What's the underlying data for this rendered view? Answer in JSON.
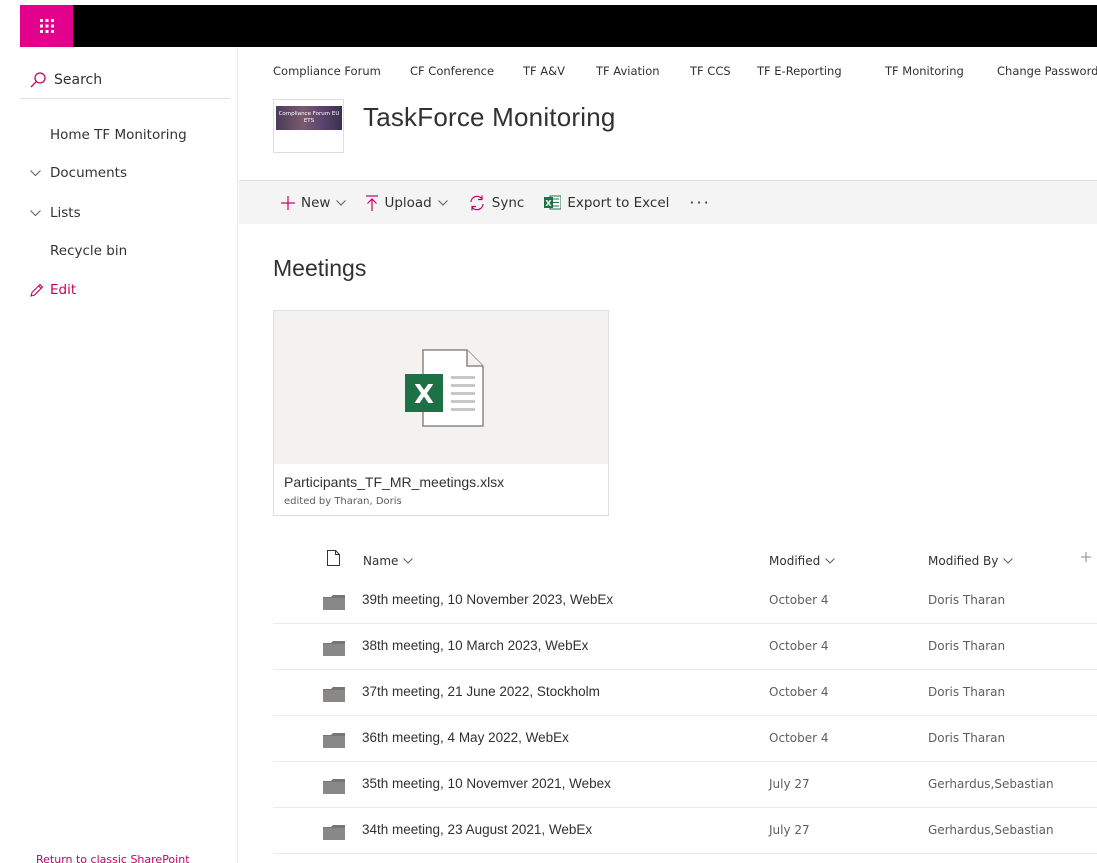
{
  "nav": {
    "search_label": "Search",
    "items": [
      {
        "label": "Home TF Monitoring"
      },
      {
        "label": "Documents"
      },
      {
        "label": "Lists"
      },
      {
        "label": "Recycle bin"
      }
    ],
    "edit_label": "Edit",
    "return_classic": "Return to classic SharePoint"
  },
  "header": {
    "top_links": [
      "Compliance Forum",
      "CF Conference",
      "TF A&V",
      "TF Aviation",
      "TF CCS",
      "TF E-Reporting",
      "TF Monitoring",
      "Change Password"
    ],
    "logo_text": "Compliance Forum EU ETS",
    "site_title": "TaskForce Monitoring"
  },
  "command_bar": {
    "new_label": "New",
    "upload_label": "Upload",
    "sync_label": "Sync",
    "export_label": "Export to Excel",
    "more_label": "···"
  },
  "page": {
    "title": "Meetings"
  },
  "file_card": {
    "name": "Participants_TF_MR_meetings.xlsx",
    "edited_by": "edited by Tharan, Doris"
  },
  "list": {
    "columns": {
      "name": "Name",
      "modified": "Modified",
      "modified_by": "Modified By"
    },
    "rows": [
      {
        "name": "39th meeting, 10 November 2023, WebEx",
        "modified": "October 4",
        "modified_by": "Doris Tharan"
      },
      {
        "name": "38th meeting, 10 March 2023, WebEx",
        "modified": "October 4",
        "modified_by": "Doris Tharan"
      },
      {
        "name": "37th meeting, 21 June 2022, Stockholm",
        "modified": "October 4",
        "modified_by": "Doris Tharan"
      },
      {
        "name": "36th meeting, 4 May 2022, WebEx",
        "modified": "October 4",
        "modified_by": "Doris Tharan"
      },
      {
        "name": "35th meeting, 10 Novemver 2021, Webex",
        "modified": "July 27",
        "modified_by": "Gerhardus,Sebastian"
      },
      {
        "name": "34th meeting, 23 August 2021, WebEx",
        "modified": "July 27",
        "modified_by": "Gerhardus,Sebastian"
      }
    ]
  },
  "colors": {
    "accent": "#e3008c",
    "link": "#c30066",
    "excel_green": "#1e7145"
  }
}
